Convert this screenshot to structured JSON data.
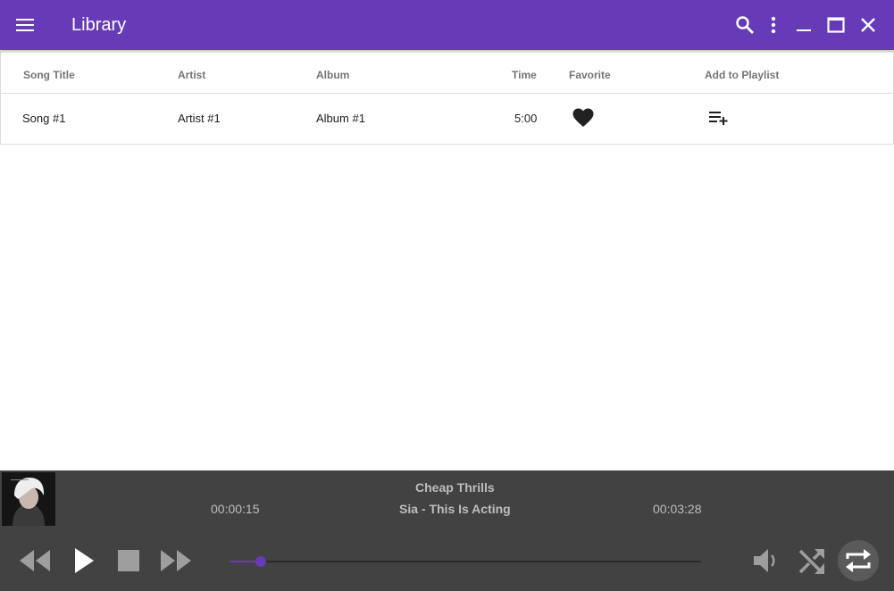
{
  "appbar": {
    "title": "Library",
    "icons": [
      "menu-icon",
      "search-icon",
      "more-vert-icon",
      "minimize-icon",
      "maximize-icon",
      "close-icon"
    ]
  },
  "table": {
    "columns": [
      "Song Title",
      "Artist",
      "Album",
      "Time",
      "Favorite",
      "Add to Playlist"
    ],
    "rows": [
      {
        "title": "Song #1",
        "artist": "Artist #1",
        "album": "Album #1",
        "time": "5:00",
        "favorite": true
      }
    ]
  },
  "player": {
    "song_title": "Cheap Thrills",
    "subtitle": "Sia - This Is Acting",
    "elapsed": "00:00:15",
    "total": "00:03:28",
    "progress": 0.066,
    "icons": [
      "rewind-icon",
      "play-icon",
      "stop-icon",
      "fast-forward-icon",
      "volume-icon",
      "shuffle-icon",
      "repeat-icon"
    ]
  },
  "colors": {
    "accent": "#673ab7",
    "player_bg": "#424242",
    "player_text": "#bdbdbd"
  }
}
